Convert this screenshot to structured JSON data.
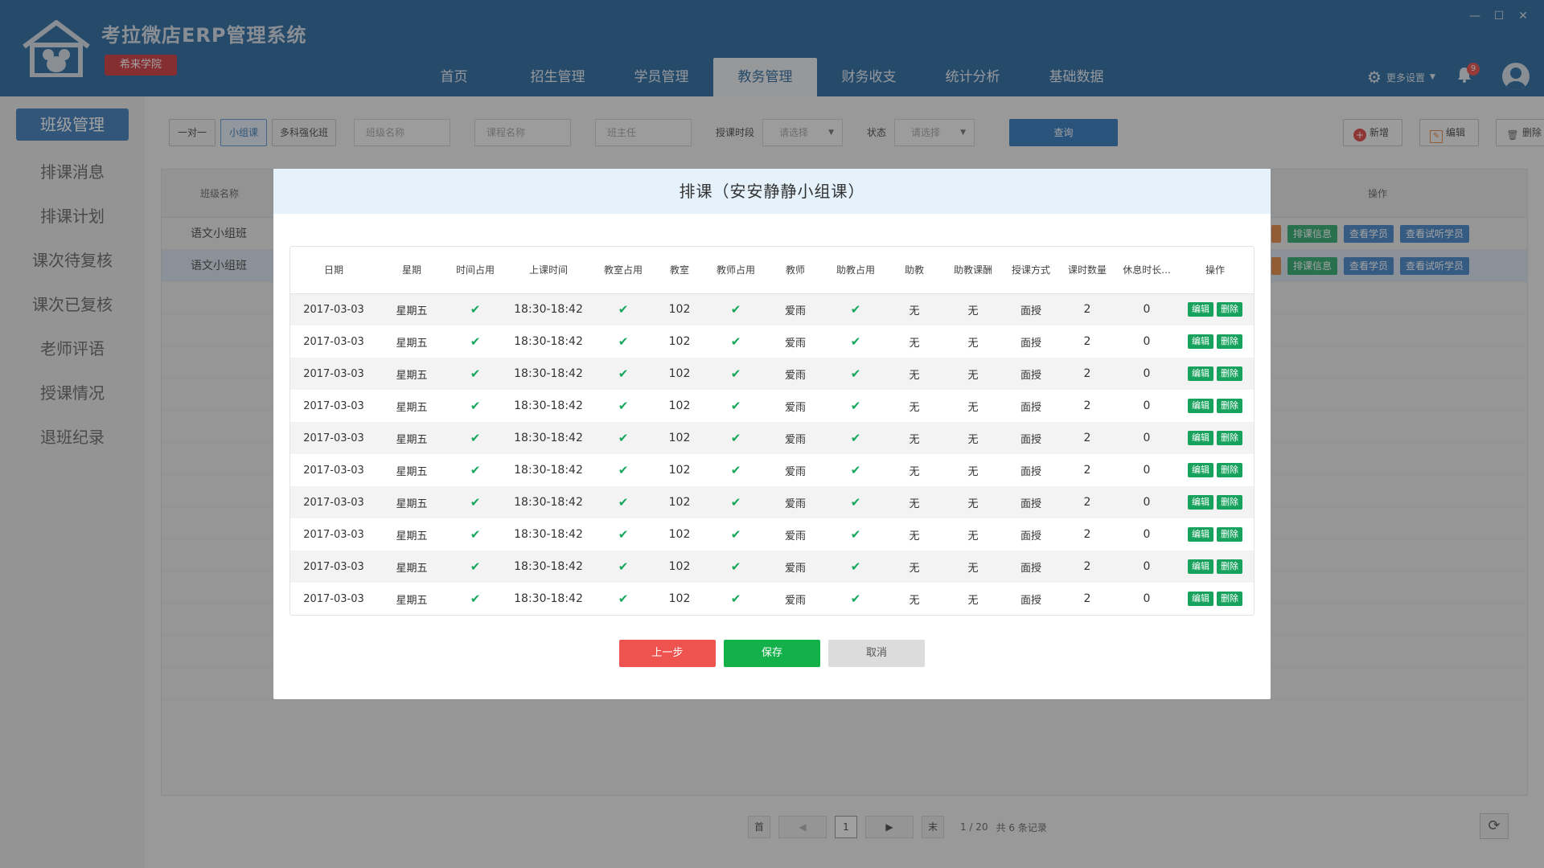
{
  "app": {
    "title": "考拉微店ERP管理系统",
    "school": "希来学院"
  },
  "window": {
    "minimize": "—",
    "maximize": "☐",
    "close": "✕"
  },
  "nav": [
    {
      "label": "首页"
    },
    {
      "label": "招生管理"
    },
    {
      "label": "学员管理"
    },
    {
      "label": "教务管理",
      "active": true
    },
    {
      "label": "财务收支"
    },
    {
      "label": "统计分析"
    },
    {
      "label": "基础数据"
    }
  ],
  "header": {
    "settings_label": "更多设置",
    "bell_count": "9"
  },
  "sidebar": [
    {
      "label": "班级管理",
      "active": true
    },
    {
      "label": "排课消息"
    },
    {
      "label": "排课计划"
    },
    {
      "label": "课次待复核"
    },
    {
      "label": "课次已复核"
    },
    {
      "label": "老师评语"
    },
    {
      "label": "授课情况"
    },
    {
      "label": "退班纪录"
    }
  ],
  "toolbar": {
    "seg_one": "一对一",
    "seg_group": "小组课",
    "seg_multi": "多科强化班",
    "class_name_ph": "班级名称",
    "course_name_ph": "课程名称",
    "teacher_ph": "班主任",
    "period_label": "授课时段",
    "period_select": "请选择",
    "status_label": "状态",
    "status_select": "请选择",
    "query": "查询",
    "add": "新增",
    "edit": "编辑",
    "delete": "删除"
  },
  "bg_table": {
    "col_class": "班级名称",
    "col_action": "操作",
    "rows": [
      {
        "name": "语文小组班",
        "selected": false
      },
      {
        "name": "语文小组班",
        "selected": true
      }
    ],
    "tag_schedule": "排课信息",
    "tag_students": "查看学员",
    "tag_trial": "查看试听学员"
  },
  "pager": {
    "first": "首",
    "prev": "◀",
    "page": "1",
    "next": "▶",
    "last": "末",
    "page_info": "1 / 20",
    "total": "共 6 条记录"
  },
  "modal": {
    "title": "排课（安安静静小组课）",
    "columns": [
      "日期",
      "星期",
      "时间占用",
      "上课时间",
      "教室占用",
      "教室",
      "教师占用",
      "教师",
      "助教占用",
      "助教",
      "助教课酬",
      "授课方式",
      "课时数量",
      "休息时长...",
      "操作"
    ],
    "rows": [
      {
        "date": "2017-03-03",
        "weekday": "星期五",
        "time": "18:30-18:42",
        "room": "102",
        "teacher": "爱雨",
        "assistant": "无",
        "assistant_pay": "无",
        "mode": "面授",
        "hours": "2",
        "rest": "0"
      },
      {
        "date": "2017-03-03",
        "weekday": "星期五",
        "time": "18:30-18:42",
        "room": "102",
        "teacher": "爱雨",
        "assistant": "无",
        "assistant_pay": "无",
        "mode": "面授",
        "hours": "2",
        "rest": "0"
      },
      {
        "date": "2017-03-03",
        "weekday": "星期五",
        "time": "18:30-18:42",
        "room": "102",
        "teacher": "爱雨",
        "assistant": "无",
        "assistant_pay": "无",
        "mode": "面授",
        "hours": "2",
        "rest": "0"
      },
      {
        "date": "2017-03-03",
        "weekday": "星期五",
        "time": "18:30-18:42",
        "room": "102",
        "teacher": "爱雨",
        "assistant": "无",
        "assistant_pay": "无",
        "mode": "面授",
        "hours": "2",
        "rest": "0"
      },
      {
        "date": "2017-03-03",
        "weekday": "星期五",
        "time": "18:30-18:42",
        "room": "102",
        "teacher": "爱雨",
        "assistant": "无",
        "assistant_pay": "无",
        "mode": "面授",
        "hours": "2",
        "rest": "0"
      },
      {
        "date": "2017-03-03",
        "weekday": "星期五",
        "time": "18:30-18:42",
        "room": "102",
        "teacher": "爱雨",
        "assistant": "无",
        "assistant_pay": "无",
        "mode": "面授",
        "hours": "2",
        "rest": "0"
      },
      {
        "date": "2017-03-03",
        "weekday": "星期五",
        "time": "18:30-18:42",
        "room": "102",
        "teacher": "爱雨",
        "assistant": "无",
        "assistant_pay": "无",
        "mode": "面授",
        "hours": "2",
        "rest": "0"
      },
      {
        "date": "2017-03-03",
        "weekday": "星期五",
        "time": "18:30-18:42",
        "room": "102",
        "teacher": "爱雨",
        "assistant": "无",
        "assistant_pay": "无",
        "mode": "面授",
        "hours": "2",
        "rest": "0"
      },
      {
        "date": "2017-03-03",
        "weekday": "星期五",
        "time": "18:30-18:42",
        "room": "102",
        "teacher": "爱雨",
        "assistant": "无",
        "assistant_pay": "无",
        "mode": "面授",
        "hours": "2",
        "rest": "0"
      },
      {
        "date": "2017-03-03",
        "weekday": "星期五",
        "time": "18:30-18:42",
        "room": "102",
        "teacher": "爱雨",
        "assistant": "无",
        "assistant_pay": "无",
        "mode": "面授",
        "hours": "2",
        "rest": "0"
      }
    ],
    "op_edit": "编辑",
    "op_delete": "删除",
    "btn_prev": "上一步",
    "btn_save": "保存",
    "btn_cancel": "取消"
  },
  "colors": {
    "header": "#125694",
    "primary": "#1c6ab7",
    "success": "#14b04a",
    "danger": "#ef5350",
    "check": "#13a85a"
  },
  "icons": {
    "logo": "house-logo-icon",
    "check": "check-icon",
    "settings": "gear-icon",
    "bell": "bell-icon",
    "avatar": "user-avatar-icon",
    "refresh": "refresh-icon"
  }
}
